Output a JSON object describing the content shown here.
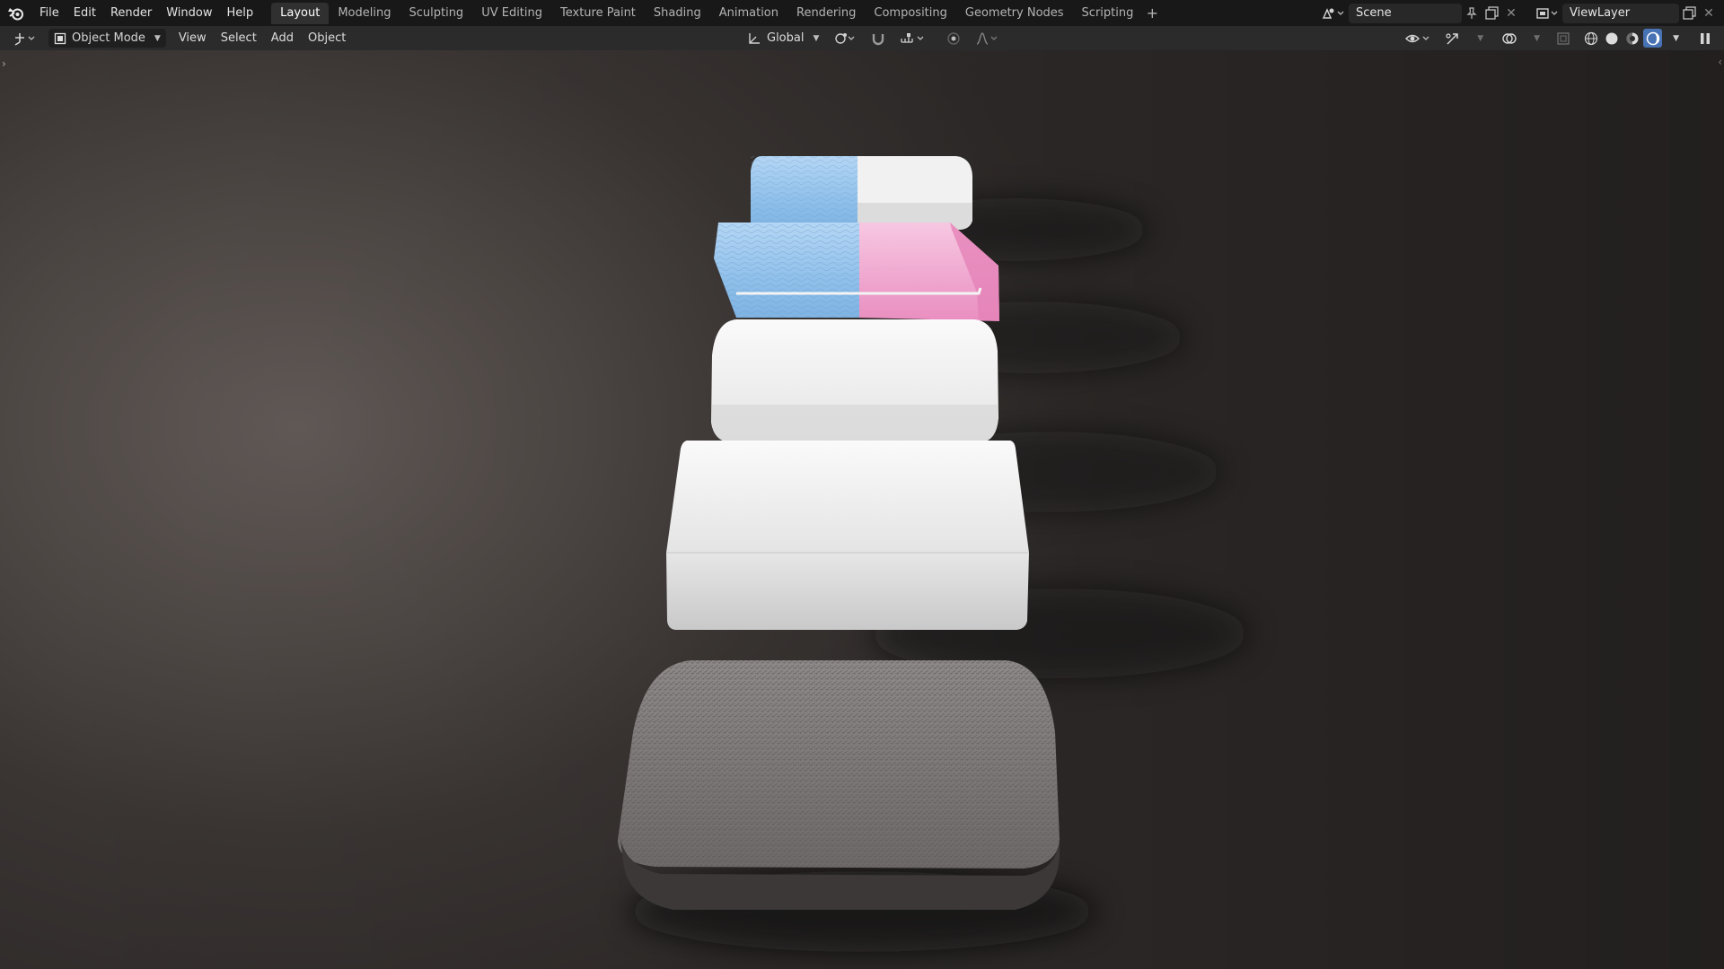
{
  "topbar": {
    "menus": [
      "File",
      "Edit",
      "Render",
      "Window",
      "Help"
    ],
    "workspace_tabs": [
      "Layout",
      "Modeling",
      "Sculpting",
      "UV Editing",
      "Texture Paint",
      "Shading",
      "Animation",
      "Rendering",
      "Compositing",
      "Geometry Nodes",
      "Scripting"
    ],
    "active_tab": "Layout",
    "add_tab": "+",
    "scene_name": "Scene",
    "view_layer_name": "ViewLayer"
  },
  "header": {
    "mode": "Object Mode",
    "menus": [
      "View",
      "Select",
      "Add",
      "Object"
    ],
    "transform_orientation": "Global"
  },
  "icons": {
    "logo": "blender-logo-icon",
    "editor_type": "3d-viewport-icon",
    "pivot": "pivot-point-icon",
    "snap": "snap-magnet-icon",
    "proportional": "proportional-editing-icon",
    "visibility": "eye-icon",
    "gizmo": "gizmo-icon",
    "overlay": "overlay-icon",
    "xray": "xray-icon",
    "shading_modes": [
      "wireframe-icon",
      "solid-icon",
      "material-preview-icon",
      "rendered-icon"
    ]
  },
  "colors": {
    "accent": "#4772b3",
    "topbar_bg": "#181818",
    "header_bg": "#2b2b2b",
    "viewport_bg": "#3a3533"
  },
  "viewport": {
    "objects": [
      {
        "name": "eraser-blue-white",
        "colors": [
          "#a8cdf0",
          "#f4f4f4"
        ]
      },
      {
        "name": "eraser-blue-pink",
        "colors": [
          "#a8cdf0",
          "#f3b8d8"
        ]
      },
      {
        "name": "soft-white-block",
        "colors": [
          "#efefef"
        ]
      },
      {
        "name": "white-box",
        "colors": [
          "#f2f2f2"
        ]
      },
      {
        "name": "gray-textured-block",
        "colors": [
          "#7b7776"
        ]
      }
    ]
  }
}
